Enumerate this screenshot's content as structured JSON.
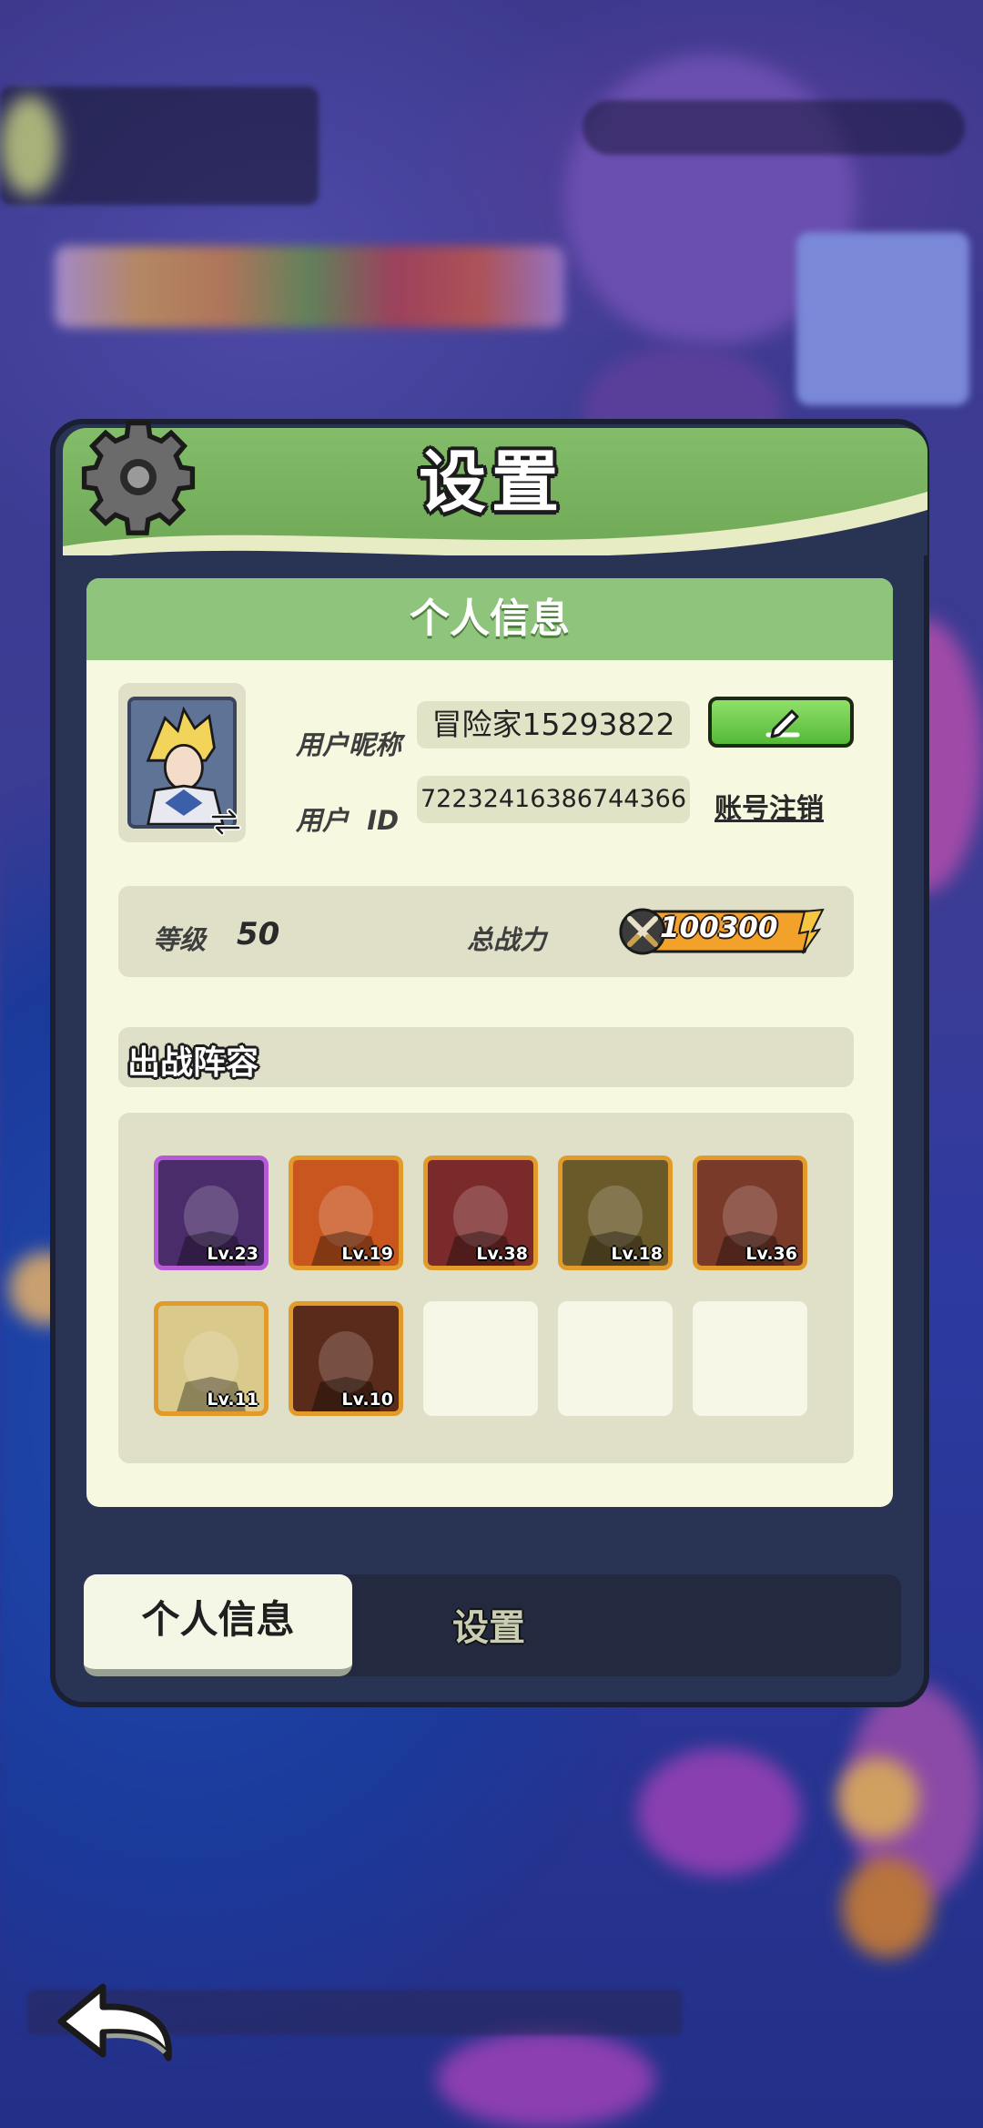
{
  "window": {
    "title": "设置"
  },
  "personal_card": {
    "header": "个人信息",
    "nickname_label": "用户昵称",
    "nickname_value": "冒险家15293822",
    "id_label": "用户  ID",
    "id_value": "72232416386744366",
    "logout_label": "账号注销",
    "edit_icon": "pencil-icon",
    "avatar_icon": "switch-avatar-icon"
  },
  "stats": {
    "level_label": "等级",
    "level_value": "50",
    "power_label": "总战力",
    "power_value": "100300",
    "power_icon": "crossed-swords-icon"
  },
  "team": {
    "title": "出战阵容",
    "heroes": [
      {
        "level": "Lv.23",
        "rarity": "purple",
        "color": "#4a2c6a"
      },
      {
        "level": "Lv.19",
        "rarity": "orange",
        "color": "#c9561f"
      },
      {
        "level": "Lv.38",
        "rarity": "orange",
        "color": "#7a2a2a"
      },
      {
        "level": "Lv.18",
        "rarity": "orange",
        "color": "#6a5a2a"
      },
      {
        "level": "Lv.36",
        "rarity": "orange",
        "color": "#7a3a2a"
      },
      {
        "level": "Lv.11",
        "rarity": "orange",
        "color": "#d9c98a"
      },
      {
        "level": "Lv.10",
        "rarity": "orange",
        "color": "#5a2a1a"
      }
    ],
    "empty_slots": 3
  },
  "tabs": [
    {
      "label": "个人信息",
      "active": true
    },
    {
      "label": "设置",
      "active": false
    }
  ],
  "colors": {
    "header_green": "#7ab562",
    "card_bg": "#f7f8e0",
    "panel_dark": "#293454",
    "edit_button": "#5cc23e",
    "power_badge": "#f2a12b"
  }
}
